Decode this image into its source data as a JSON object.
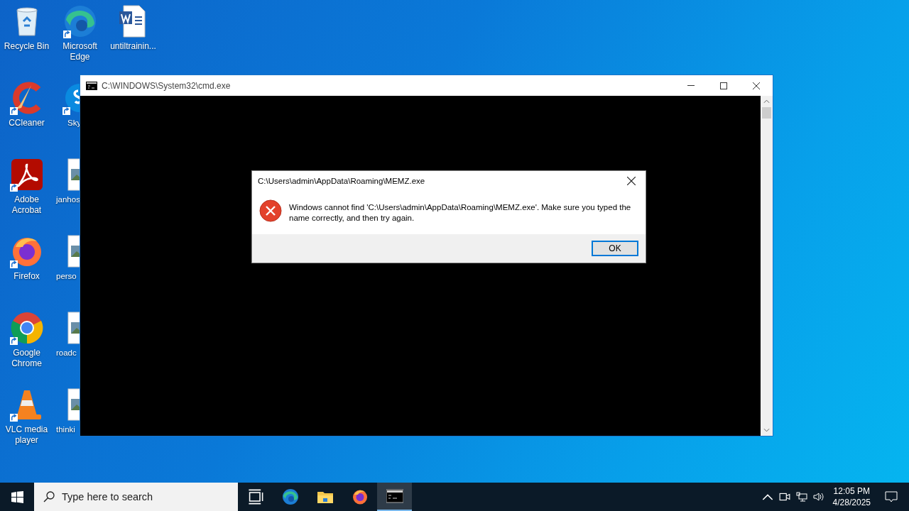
{
  "desktop_columns": [
    [
      {
        "label": "Recycle Bin",
        "kind": "recycle",
        "shortcut": false
      },
      {
        "label": "CCleaner",
        "kind": "ccleaner",
        "shortcut": true
      },
      {
        "label": "Adobe Acrobat",
        "kind": "acrobat",
        "shortcut": true
      },
      {
        "label": "Firefox",
        "kind": "firefox",
        "shortcut": true
      },
      {
        "label": "Google Chrome",
        "kind": "chrome",
        "shortcut": true
      },
      {
        "label": "VLC media player",
        "kind": "vlc",
        "shortcut": true
      }
    ],
    [
      {
        "label": "Microsoft Edge",
        "kind": "edge",
        "shortcut": true
      },
      {
        "label": "Sky",
        "kind": "skype",
        "shortcut": true
      },
      {
        "label": "janhos",
        "kind": "image",
        "shortcut": false
      },
      {
        "label": "perso",
        "kind": "image",
        "shortcut": false
      },
      {
        "label": "roadc",
        "kind": "image",
        "shortcut": false
      },
      {
        "label": "thinki",
        "kind": "image",
        "shortcut": false
      }
    ],
    [
      {
        "label": "untiltrainin...",
        "kind": "word",
        "shortcut": false
      }
    ]
  ],
  "console_window": {
    "title": "C:\\WINDOWS\\System32\\cmd.exe"
  },
  "dialog": {
    "title": "C:\\Users\\admin\\AppData\\Roaming\\MEMZ.exe",
    "message": "Windows cannot find 'C:\\Users\\admin\\AppData\\Roaming\\MEMZ.exe'. Make sure you typed the name correctly, and then try again.",
    "button": "OK"
  },
  "taskbar": {
    "search": {
      "placeholder": "Type here to search"
    },
    "apps": [
      {
        "kind": "taskview",
        "selected": false
      },
      {
        "kind": "edge",
        "selected": false
      },
      {
        "kind": "explorer",
        "selected": false
      },
      {
        "kind": "firefox",
        "selected": false
      },
      {
        "kind": "cmd",
        "selected": true
      }
    ],
    "time": "12:05 PM",
    "date": "4/28/2025"
  }
}
